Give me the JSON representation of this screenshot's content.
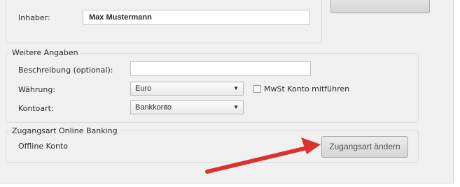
{
  "owner_group": {
    "owner_label": "Inhaber:",
    "owner_value": "Max Mustermann"
  },
  "top_right_button": {
    "label": ""
  },
  "further_group": {
    "title": "Weitere Angaben",
    "description_label": "Beschreibung (optional):",
    "description_value": "",
    "currency_label": "Währung:",
    "currency_value": "Euro",
    "vat_checkbox_label": "MwSt Konto mitführen",
    "vat_checked": false,
    "account_type_label": "Kontoart:",
    "account_type_value": "Bankkonto"
  },
  "access_group": {
    "title": "Zugangsart Online Banking",
    "mode_text": "Offline Konto",
    "change_button_label": "Zugangsart ändern"
  },
  "annotation": {
    "arrow_color": "#e53935",
    "icon": "arrow-icon"
  }
}
